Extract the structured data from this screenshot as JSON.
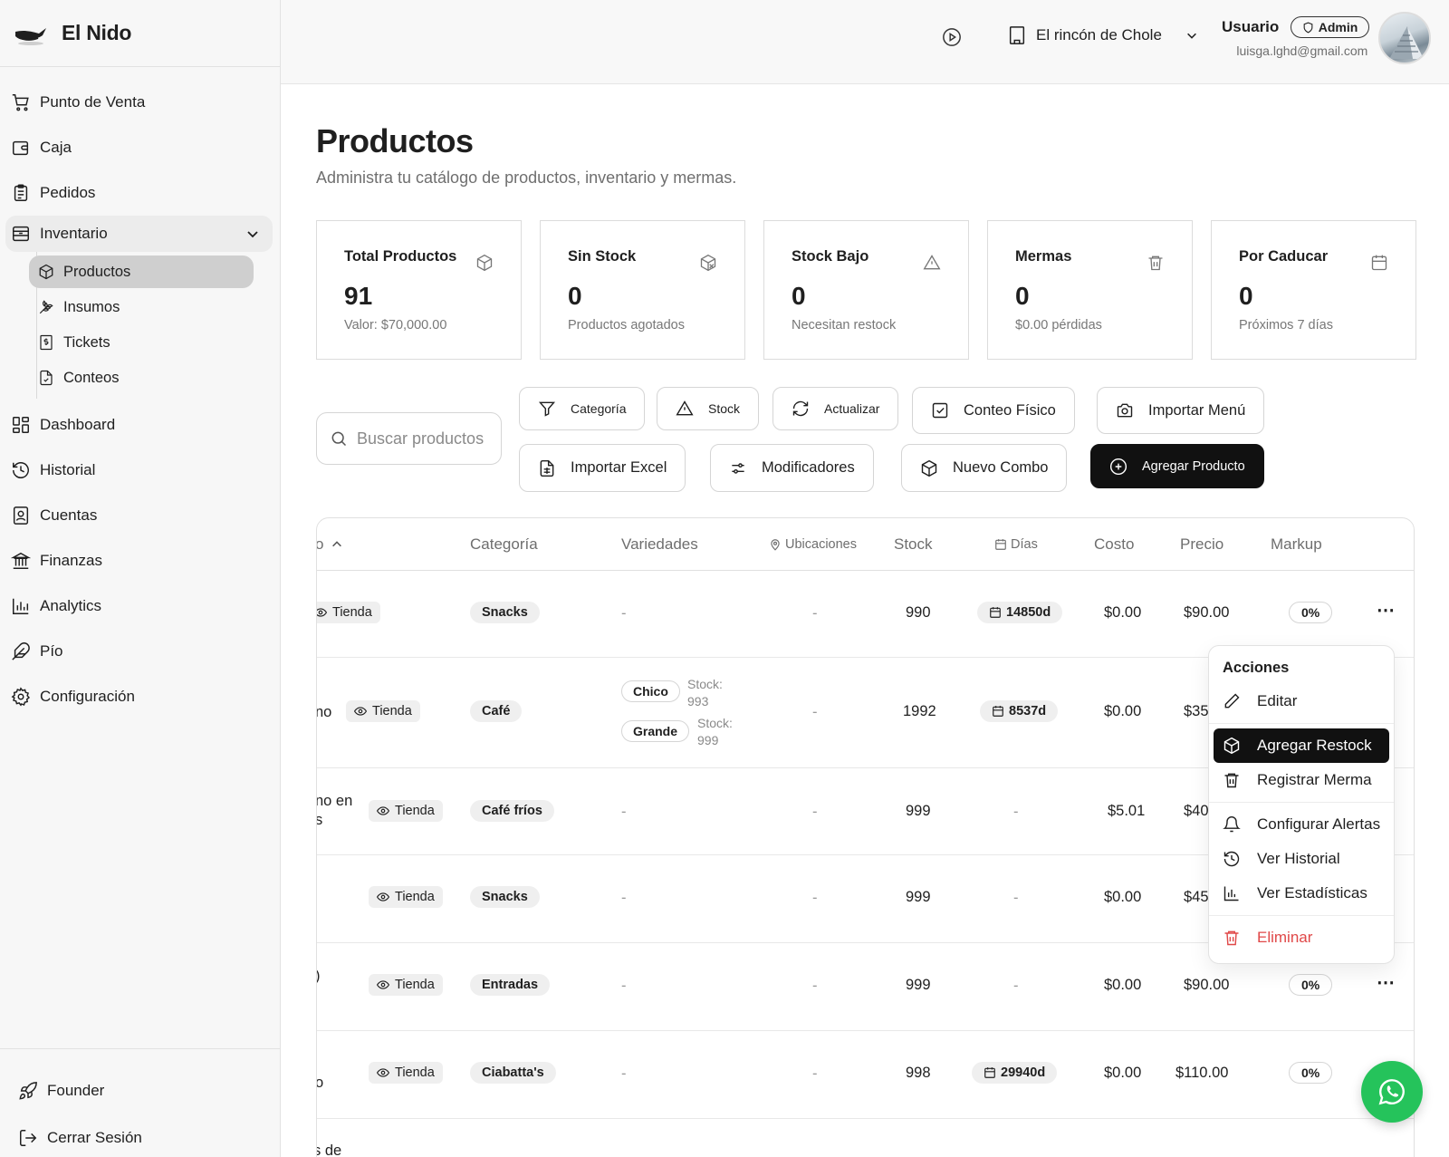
{
  "brand": {
    "name": "El Nido"
  },
  "sidebar": {
    "items": [
      {
        "label": "Punto de Venta",
        "icon": "cart-icon"
      },
      {
        "label": "Caja",
        "icon": "wallet-icon"
      },
      {
        "label": "Pedidos",
        "icon": "clipboard-icon"
      }
    ],
    "inventory": {
      "label": "Inventario",
      "children": [
        {
          "label": "Productos",
          "icon": "box-icon",
          "active": true
        },
        {
          "label": "Insumos",
          "icon": "wheat-icon"
        },
        {
          "label": "Tickets",
          "icon": "receipt-icon"
        },
        {
          "label": "Conteos",
          "icon": "file-check-icon"
        }
      ]
    },
    "items2": [
      {
        "label": "Dashboard",
        "icon": "grid-icon"
      },
      {
        "label": "Historial",
        "icon": "history-icon"
      },
      {
        "label": "Cuentas",
        "icon": "contact-icon"
      },
      {
        "label": "Finanzas",
        "icon": "bank-icon"
      },
      {
        "label": "Analytics",
        "icon": "chart-icon"
      },
      {
        "label": "Pío",
        "icon": "feather-icon"
      },
      {
        "label": "Configuración",
        "icon": "gear-icon"
      }
    ],
    "bottom": [
      {
        "label": "Founder",
        "icon": "rocket-icon"
      },
      {
        "label": "Cerrar Sesión",
        "icon": "logout-icon"
      }
    ]
  },
  "header": {
    "store_name": "El rincón de Chole",
    "user_label": "Usuario",
    "role_badge": "Admin",
    "email": "luisga.lghd@gmail.com"
  },
  "page": {
    "title": "Productos",
    "subtitle": "Administra tu catálogo de productos, inventario y mermas."
  },
  "stats": [
    {
      "title": "Total Productos",
      "value": "91",
      "sub": "Valor: $70,000.00",
      "icon": "box-icon"
    },
    {
      "title": "Sin Stock",
      "value": "0",
      "sub": "Productos agotados",
      "icon": "box-x-icon"
    },
    {
      "title": "Stock Bajo",
      "value": "0",
      "sub": "Necesitan restock",
      "icon": "warning-icon"
    },
    {
      "title": "Mermas",
      "value": "0",
      "sub": "$0.00 pérdidas",
      "icon": "trash-icon"
    },
    {
      "title": "Por Caducar",
      "value": "0",
      "sub": "Próximos 7 días",
      "icon": "calendar-icon"
    }
  ],
  "search": {
    "placeholder": "Buscar productos"
  },
  "toolbar": {
    "categoria": "Categoría",
    "stock": "Stock",
    "actualizar": "Actualizar",
    "conteo": "Conteo Físico",
    "importar_menu": "Importar Menú",
    "importar_excel": "Importar Excel",
    "modificadores": "Modificadores",
    "nuevo_combo": "Nuevo Combo",
    "agregar": "Agregar Producto"
  },
  "table": {
    "headers": {
      "producto": "o",
      "categoria": "Categoría",
      "variedades": "Variedades",
      "ubicaciones": "Ubicaciones",
      "stock": "Stock",
      "dias": "Días",
      "costo": "Costo",
      "precio": "Precio",
      "markup": "Markup"
    },
    "rows": [
      {
        "name": "",
        "name2": "",
        "tag": "Tienda",
        "category": "Snacks",
        "variedades": "-",
        "ubicaciones": "-",
        "stock": "990",
        "dias": "14850d",
        "costo": "$0.00",
        "precio": "$90.00",
        "markup": "0%"
      },
      {
        "name": "no",
        "name2": "",
        "tag": "Tienda",
        "category": "Café",
        "var1": "Chico",
        "var1_stock": "Stock:",
        "var1_stock_val": "993",
        "var2": "Grande",
        "var2_stock": "Stock:",
        "var2_stock_val": "999",
        "ubicaciones": "-",
        "stock": "1992",
        "dias": "8537d",
        "costo": "$0.00",
        "precio": "$35.",
        "markup": ""
      },
      {
        "name": "no en",
        "name2": "s",
        "tag": "Tienda",
        "category": "Café fríos",
        "variedades": "-",
        "ubicaciones": "-",
        "stock": "999",
        "dias": "-",
        "costo": "$5.01",
        "precio": "$40.",
        "markup": ""
      },
      {
        "name": "",
        "name2": "",
        "tag": "Tienda",
        "category": "Snacks",
        "variedades": "-",
        "ubicaciones": "-",
        "stock": "999",
        "dias": "-",
        "costo": "$0.00",
        "precio": "$45.",
        "markup": ""
      },
      {
        "name": ")",
        "name2": "",
        "tag": "Tienda",
        "category": "Entradas",
        "variedades": "-",
        "ubicaciones": "-",
        "stock": "999",
        "dias": "-",
        "costo": "$0.00",
        "precio": "$90.00",
        "markup": "0%"
      },
      {
        "name": "",
        "name2": "o",
        "tag": "Tienda",
        "category": "Ciabatta's",
        "variedades": "-",
        "ubicaciones": "-",
        "stock": "998",
        "dias": "29940d",
        "costo": "$0.00",
        "precio": "$110.00",
        "markup": "0%"
      },
      {
        "name": "s de",
        "name2": "",
        "tag": "",
        "category": "",
        "variedades": "",
        "ubicaciones": "",
        "stock": "",
        "dias": "",
        "costo": "",
        "precio": "",
        "markup": ""
      }
    ]
  },
  "menu": {
    "title": "Acciones",
    "items": [
      {
        "label": "Editar",
        "icon": "pencil-icon"
      },
      {
        "label": "Agregar Restock",
        "icon": "box-icon"
      },
      {
        "label": "Registrar Merma",
        "icon": "trash-icon"
      },
      {
        "label": "Configurar Alertas",
        "icon": "bell-icon"
      },
      {
        "label": "Ver Historial",
        "icon": "history-icon"
      },
      {
        "label": "Ver Estadísticas",
        "icon": "chart-icon"
      },
      {
        "label": "Eliminar",
        "icon": "trash-red-icon"
      }
    ]
  },
  "colors": {
    "accent": "#111111",
    "danger": "#e04848",
    "whatsapp": "#25c35b",
    "active_nav": "#cfcfcf"
  }
}
